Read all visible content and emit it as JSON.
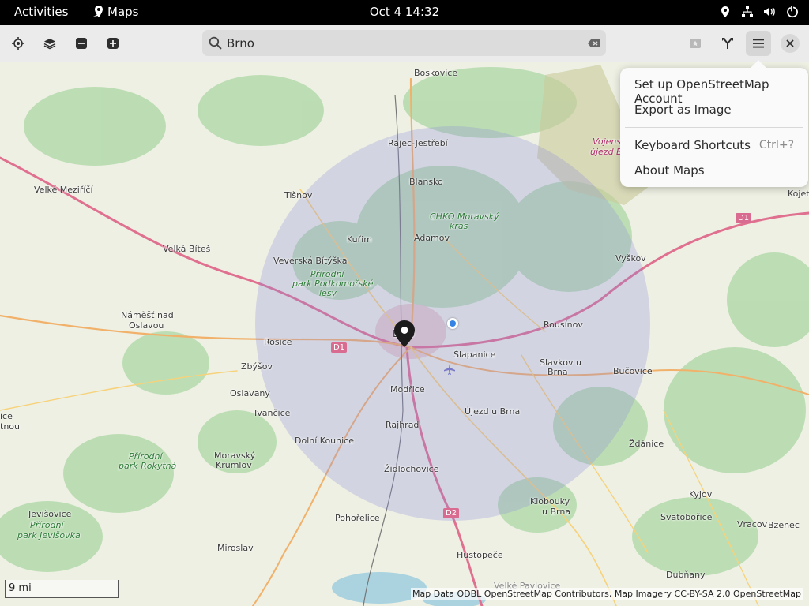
{
  "topbar": {
    "activities": "Activities",
    "app_name": "Maps",
    "clock": "Oct 4  14:32"
  },
  "header": {
    "search_value": "Brno"
  },
  "menu": {
    "items": [
      {
        "label": "Set up OpenStreetMap Account"
      },
      {
        "label": "Export as Image"
      },
      {
        "label": "Keyboard Shortcuts",
        "accel": "Ctrl+?"
      },
      {
        "label": "About Maps"
      }
    ]
  },
  "map": {
    "places": [
      "Boskovice",
      "Rájec-Jestřebí",
      "Blansko",
      "Tišnov",
      "Velké Meziříčí",
      "Velká Bíteš",
      "Kuřim",
      "Adamov",
      "Veverská Bítýška",
      "Náměšť nad",
      "Oslavou",
      "Rosice",
      "Brno",
      "Zbýšov",
      "Rousínov",
      "Vyškov",
      "Šlapanice",
      "Slavkov u",
      "Brna",
      "Bučovice",
      "Modřice",
      "Oslavany",
      "Ivančice",
      "Újezd u Brna",
      "Rajhrad",
      "Dolní Kounice",
      "Ždánice",
      "Moravský",
      "Krumlov",
      "Židlochovice",
      "Klobouky",
      "u Brna",
      "Kyjov",
      "Jevišovice",
      "Pohořelice",
      "Svatobořice",
      "Vracov",
      "Bzenec",
      "Miroslav",
      "Hustopeče",
      "Dubňany",
      "Velké Pavlovice",
      "Kojet",
      "Vojensk",
      "újezd Břez",
      "ice",
      "tnou"
    ],
    "parks": [
      "CHKO Moravský",
      "kras",
      "Přírodní",
      "park Podkomořské",
      "lesy",
      "Přírodní",
      "park Rokytná",
      "Přírodní",
      "park Jevišovka"
    ],
    "shields": [
      "D1",
      "D1",
      "D2"
    ],
    "scale": "9 mi",
    "attribution": "Map Data ODBL OpenStreetMap Contributors, Map Imagery CC-BY-SA 2.0 OpenStreetMap"
  },
  "colors": {
    "topbar_bg": "#000000",
    "header_bg": "#ebebeb",
    "map_land": "#eef0e4",
    "forest": "#a8d5a0",
    "radius_overlay": "#8c8cdc",
    "motorway": "#e0708f",
    "primary_road": "#f1b16a"
  }
}
